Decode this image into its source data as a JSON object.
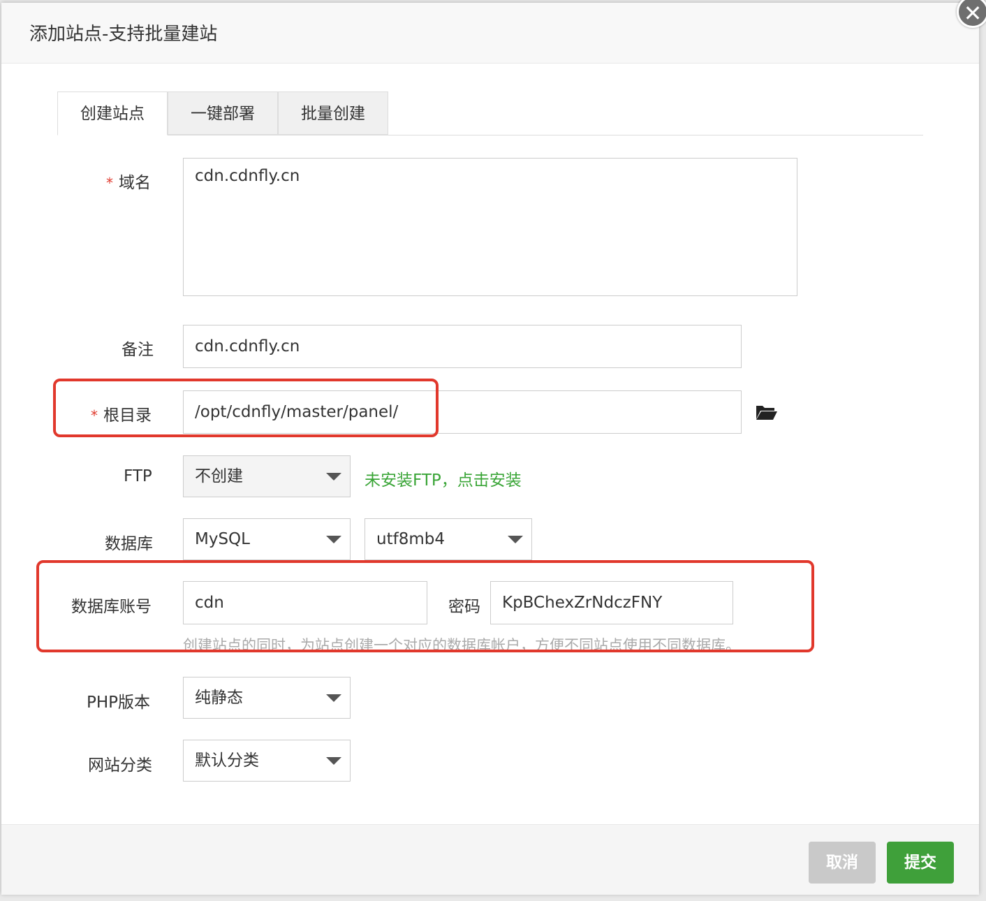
{
  "dialog": {
    "title": "添加站点-支持批量建站",
    "close_icon": "close-icon"
  },
  "tabs": [
    {
      "label": "创建站点",
      "active": true
    },
    {
      "label": "一键部署",
      "active": false
    },
    {
      "label": "批量创建",
      "active": false
    }
  ],
  "form": {
    "domain": {
      "label": "域名",
      "required_mark": "*",
      "value": "cdn.cdnfly.cn"
    },
    "remark": {
      "label": "备注",
      "value": "cdn.cdnfly.cn"
    },
    "root": {
      "label": "根目录",
      "required_mark": "*",
      "value": "/opt/cdnfly/master/panel/",
      "browse_icon": "folder-open-icon"
    },
    "ftp": {
      "label": "FTP",
      "selected": "不创建",
      "install_link": "未安装FTP，点击安装"
    },
    "database": {
      "label": "数据库",
      "type_selected": "MySQL",
      "charset_selected": "utf8mb4"
    },
    "db_account": {
      "label": "数据库账号",
      "username": "cdn",
      "password_label": "密码",
      "password": "KpBChexZrNdczFNY",
      "hint": "创建站点的同时，为站点创建一个对应的数据库帐户，方便不同站点使用不同数据库。"
    },
    "php": {
      "label": "PHP版本",
      "selected": "纯静态"
    },
    "category": {
      "label": "网站分类",
      "selected": "默认分类"
    }
  },
  "footer": {
    "cancel_label": "取消",
    "submit_label": "提交"
  },
  "colors": {
    "accent_green": "#3fa03a",
    "link_green": "#3aa537",
    "required_red": "#e03b2f",
    "highlight_red": "#e1382c"
  }
}
